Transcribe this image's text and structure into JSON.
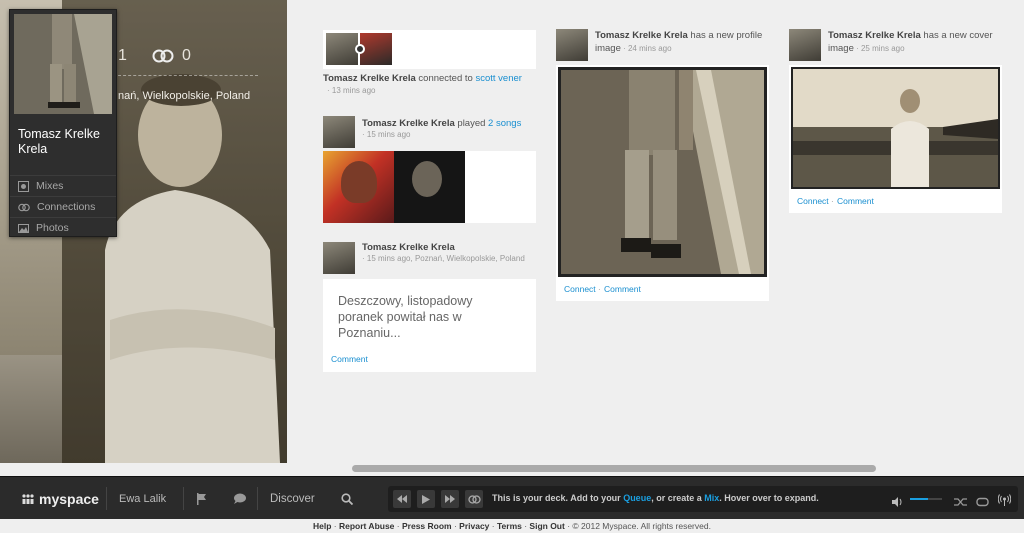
{
  "profile": {
    "name": "Tomasz Krelke Krela",
    "mixes_count": "1",
    "connections_count": "0",
    "location": "nań, Wielkopolskie, Poland",
    "nav": [
      {
        "label": "Mixes",
        "icon": "mixes-icon"
      },
      {
        "label": "Connections",
        "icon": "connections-icon"
      },
      {
        "label": "Photos",
        "icon": "photos-icon"
      }
    ]
  },
  "feed": {
    "connected": {
      "actor": "Tomasz Krelke Krela",
      "verb": " connected to ",
      "target": "scott vener",
      "time": "13 mins ago"
    },
    "played": {
      "actor": "Tomasz Krelke Krela",
      "verb": " played ",
      "target": "2 songs",
      "time": "15 mins ago"
    },
    "status": {
      "actor": "Tomasz Krelke Krela",
      "time": "15 mins ago",
      "location": "Poznań, Wielkopolskie, Poland",
      "text": "Deszczowy, listopadowy poranek powitał nas w Poznaniu...",
      "comment": "Comment"
    },
    "profile_image": {
      "actor": "Tomasz Krelke Krela",
      "verb": " has a new profile image",
      "time": "24 mins ago",
      "connect": "Connect",
      "comment": "Comment"
    },
    "cover_image": {
      "actor": "Tomasz Krelke Krela",
      "verb": " has a new cover image",
      "time": "25 mins ago",
      "connect": "Connect",
      "comment": "Comment"
    }
  },
  "bottom_bar": {
    "logo": "myspace",
    "user": "Ewa Lalik",
    "discover": "Discover",
    "deck_msg_1": "This is your deck. Add to your ",
    "deck_queue": "Queue",
    "deck_msg_2": ", or create a ",
    "deck_mix": "Mix",
    "deck_msg_3": ". Hover over to expand."
  },
  "footer": {
    "links": [
      "Help",
      "Report Abuse",
      "Press Room",
      "Privacy",
      "Terms",
      "Sign Out"
    ],
    "copyright": "© 2012 Myspace. All rights reserved."
  },
  "colors": {
    "accent": "#1a8fd0",
    "bar": "#2b2b2b"
  }
}
